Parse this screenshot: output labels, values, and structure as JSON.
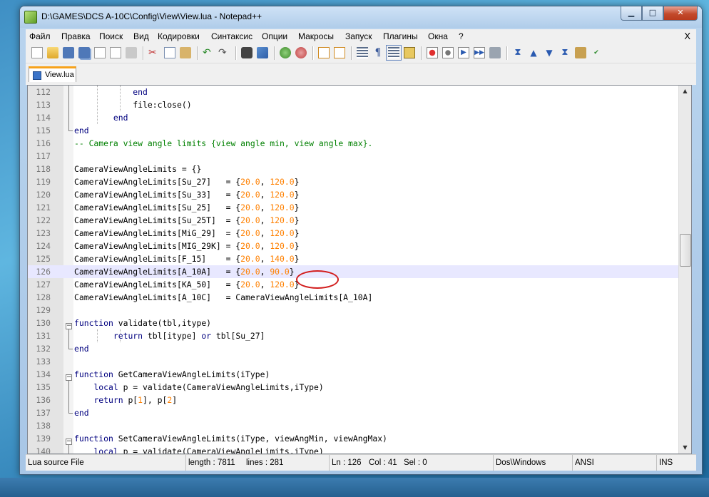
{
  "window": {
    "title": "D:\\GAMES\\DCS A-10C\\Config\\View\\View.lua - Notepad++"
  },
  "menu": [
    "Файл",
    "Правка",
    "Поиск",
    "Вид",
    "Кодировки",
    "Синтаксис",
    "Опции",
    "Макросы",
    "Запуск",
    "Плагины",
    "Окна",
    "?"
  ],
  "menu_close": "X",
  "caption_buttons": {
    "minimize": "▁",
    "maximize": "□",
    "close": "✕"
  },
  "tab": {
    "label": "View.lua"
  },
  "code_lines": [
    {
      "n": "112",
      "text": "            end"
    },
    {
      "n": "113",
      "text": "            file:close()"
    },
    {
      "n": "114",
      "text": "        end"
    },
    {
      "n": "115",
      "text": "end"
    },
    {
      "n": "116",
      "text": "-- Camera view angle limits {view angle min, view angle max}."
    },
    {
      "n": "117",
      "text": ""
    },
    {
      "n": "118",
      "text": "CameraViewAngleLimits = {}"
    },
    {
      "n": "119",
      "text": "CameraViewAngleLimits[Su_27]   = {20.0, 120.0}"
    },
    {
      "n": "120",
      "text": "CameraViewAngleLimits[Su_33]   = {20.0, 120.0}"
    },
    {
      "n": "121",
      "text": "CameraViewAngleLimits[Su_25]   = {20.0, 120.0}"
    },
    {
      "n": "122",
      "text": "CameraViewAngleLimits[Su_25T]  = {20.0, 120.0}"
    },
    {
      "n": "123",
      "text": "CameraViewAngleLimits[MiG_29]  = {20.0, 120.0}"
    },
    {
      "n": "124",
      "text": "CameraViewAngleLimits[MIG_29K] = {20.0, 120.0}"
    },
    {
      "n": "125",
      "text": "CameraViewAngleLimits[F_15]    = {20.0, 140.0}"
    },
    {
      "n": "126",
      "text": "CameraViewAngleLimits[A_10A]   = {20.0, 90.0}"
    },
    {
      "n": "127",
      "text": "CameraViewAngleLimits[KA_50]   = {20.0, 120.0}"
    },
    {
      "n": "128",
      "text": "CameraViewAngleLimits[A_10C]   = CameraViewAngleLimits[A_10A]"
    },
    {
      "n": "129",
      "text": ""
    },
    {
      "n": "130",
      "text": "function validate(tbl,itype)"
    },
    {
      "n": "131",
      "text": "        return tbl[itype] or tbl[Su_27]"
    },
    {
      "n": "132",
      "text": "end"
    },
    {
      "n": "133",
      "text": ""
    },
    {
      "n": "134",
      "text": "function GetCameraViewAngleLimits(iType)"
    },
    {
      "n": "135",
      "text": "    local p = validate(CameraViewAngleLimits,iType)"
    },
    {
      "n": "136",
      "text": "    return p[1], p[2]"
    },
    {
      "n": "137",
      "text": "end"
    },
    {
      "n": "138",
      "text": ""
    },
    {
      "n": "139",
      "text": "function SetCameraViewAngleLimits(iType, viewAngMin, viewAngMax)"
    },
    {
      "n": "140",
      "text": "    local p = validate(CameraViewAngleLimits,iType)"
    }
  ],
  "current_line": "126",
  "status": {
    "file_type": "Lua source File",
    "length": "length : 7811",
    "lines": "lines : 281",
    "ln": "Ln : 126",
    "col": "Col : 41",
    "sel": "Sel : 0",
    "eol": "Dos\\Windows",
    "encoding": "ANSI",
    "mode": "INS"
  },
  "colors": {
    "keyword": "#00007f",
    "number": "#ff8000",
    "comment": "#008000",
    "highlight_circle": "#d21d1d",
    "tab_accent": "#f7a21b"
  }
}
